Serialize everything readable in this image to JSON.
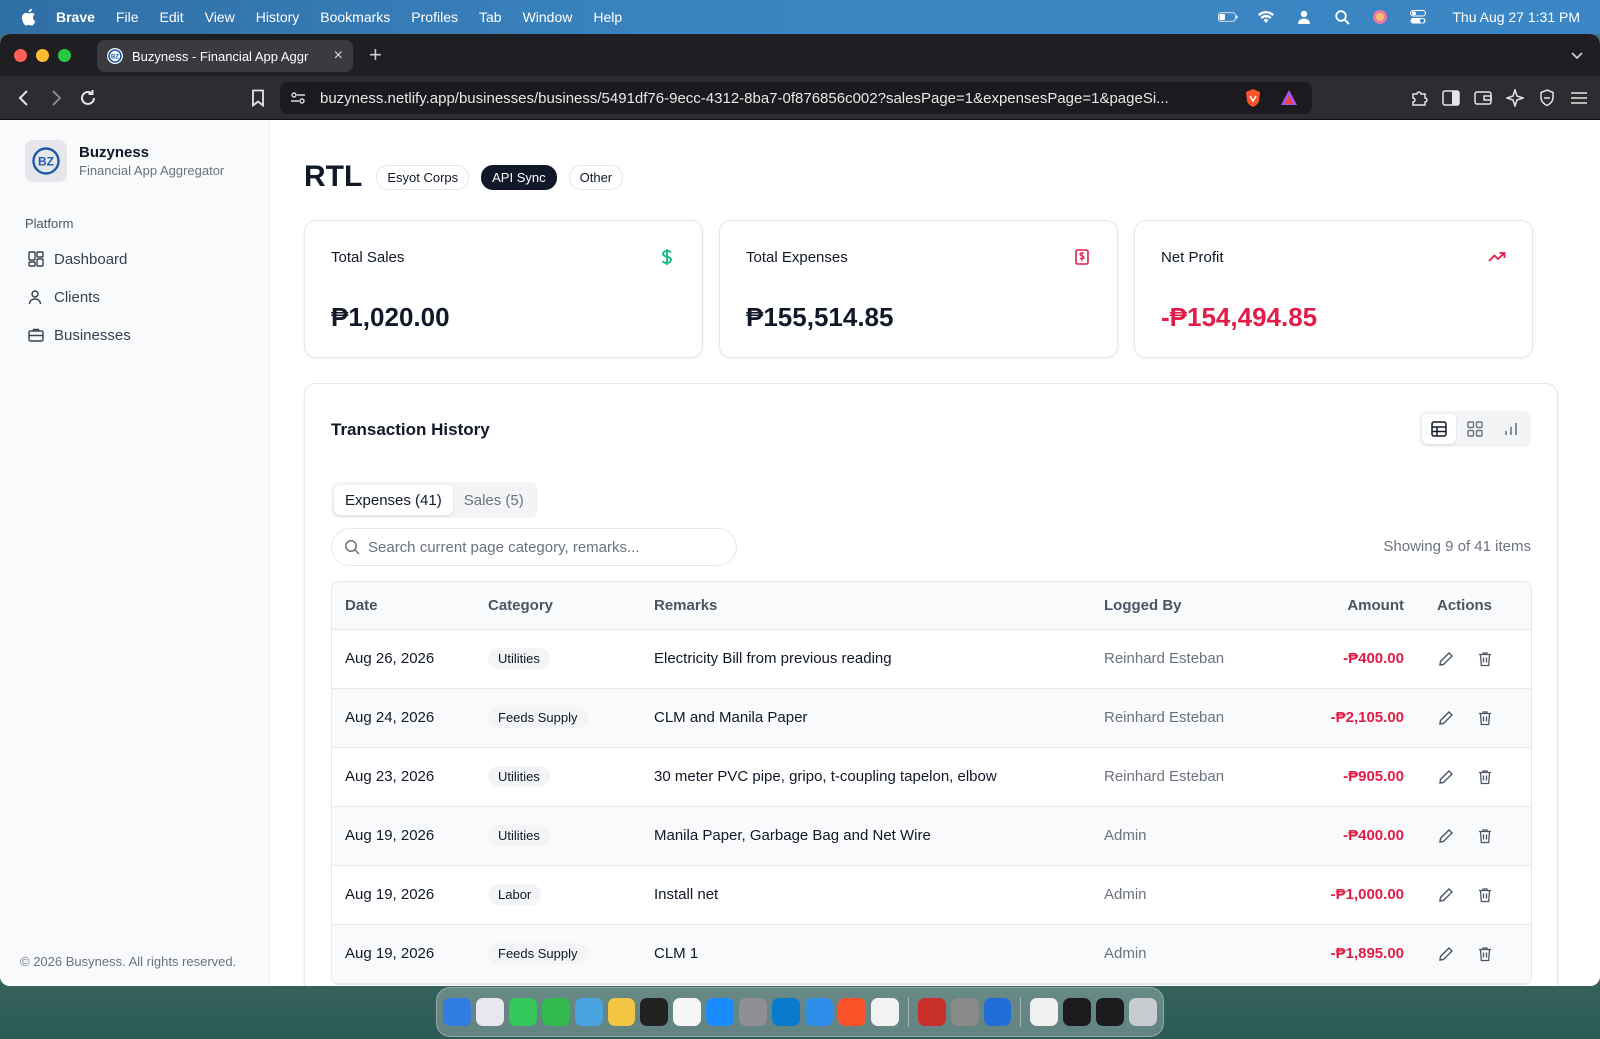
{
  "menubar": {
    "items": [
      "Brave",
      "File",
      "Edit",
      "View",
      "History",
      "Bookmarks",
      "Profiles",
      "Tab",
      "Window",
      "Help"
    ],
    "clock": "Thu Aug 27  1:31 PM"
  },
  "browser": {
    "tab_title": "Buzyness - Financial App Aggr",
    "tab_close": "×",
    "new_tab": "+",
    "url": "buzyness.netlify.app/businesses/business/5491df76-9ecc-4312-8ba7-0f876856c002?salesPage=1&expensesPage=1&pageSi..."
  },
  "brand": {
    "name": "Buzyness",
    "subtitle": "Financial App Aggregator",
    "logo_text": "BZ"
  },
  "sidebar": {
    "group_label": "Platform",
    "items": [
      {
        "label": "Dashboard",
        "icon": "dashboard-icon"
      },
      {
        "label": "Clients",
        "icon": "user-icon"
      },
      {
        "label": "Businesses",
        "icon": "briefcase-icon"
      }
    ],
    "copyright": "© 2026 Busyness. All rights reserved."
  },
  "page": {
    "title": "RTL",
    "tags": [
      "Esyot Corps",
      "API Sync",
      "Other"
    ]
  },
  "stats": [
    {
      "label": "Total Sales",
      "value": "₱1,020.00",
      "icon": "dollar-icon",
      "color": "#10b981"
    },
    {
      "label": "Total Expenses",
      "value": "₱155,514.85",
      "icon": "receipt-icon",
      "color": "#e11d48"
    },
    {
      "label": "Net Profit",
      "value": "-₱154,494.85",
      "icon": "trending-up-icon",
      "color": "#e11d48"
    }
  ],
  "transactions": {
    "title": "Transaction History",
    "tabs": [
      "Expenses (41)",
      "Sales (5)"
    ],
    "search_placeholder": "Search current page category, remarks...",
    "showing": "Showing 9 of 41 items",
    "columns": [
      "Date",
      "Category",
      "Remarks",
      "Logged By",
      "Amount",
      "Actions"
    ],
    "rows": [
      {
        "date": "Aug 26, 2026",
        "category": "Utilities",
        "remarks": "Electricity Bill from previous reading",
        "logged_by": "Reinhard Esteban",
        "amount": "-₱400.00"
      },
      {
        "date": "Aug 24, 2026",
        "category": "Feeds Supply",
        "remarks": "CLM and Manila Paper",
        "logged_by": "Reinhard Esteban",
        "amount": "-₱2,105.00"
      },
      {
        "date": "Aug 23, 2026",
        "category": "Utilities",
        "remarks": "30 meter PVC pipe, gripo, t-coupling tapelon, elbow",
        "logged_by": "Reinhard Esteban",
        "amount": "-₱905.00"
      },
      {
        "date": "Aug 19, 2026",
        "category": "Utilities",
        "remarks": "Manila Paper, Garbage Bag and Net Wire",
        "logged_by": "Admin",
        "amount": "-₱400.00"
      },
      {
        "date": "Aug 19, 2026",
        "category": "Labor",
        "remarks": "Install net",
        "logged_by": "Admin",
        "amount": "-₱1,000.00"
      },
      {
        "date": "Aug 19, 2026",
        "category": "Feeds Supply",
        "remarks": "CLM 1",
        "logged_by": "Admin",
        "amount": "-₱1,895.00"
      }
    ]
  },
  "colors": {
    "accent_negative": "#e11d48",
    "accent_positive": "#10b981",
    "brand_blue": "#1e5aa8"
  }
}
